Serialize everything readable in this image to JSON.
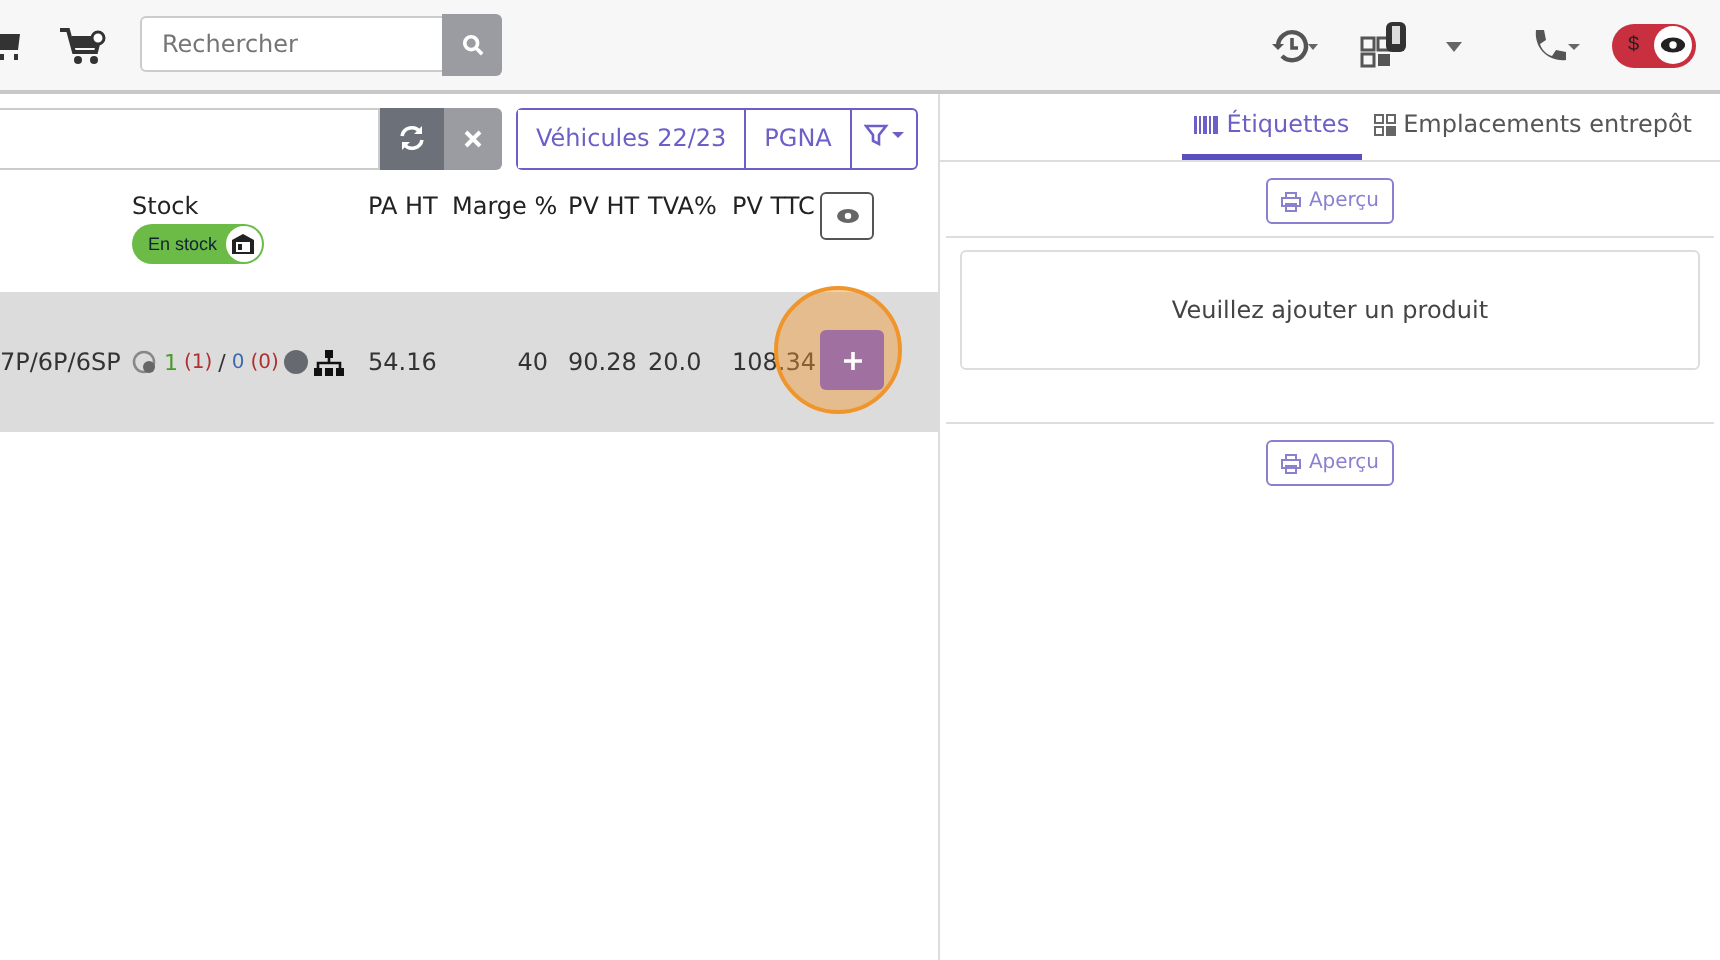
{
  "search": {
    "placeholder": "Rechercher"
  },
  "price_toggle": {
    "label": "$",
    "on": true
  },
  "tabs": [
    {
      "label": "Étiquettes",
      "selected": true,
      "kind": "barcode"
    },
    {
      "label": "Emplacements entrepôt",
      "selected": false,
      "kind": "qr"
    }
  ],
  "filters": [
    "Véhicules 22/23",
    "PGNA"
  ],
  "columns": {
    "stock": "Stock",
    "stock_toggle": {
      "label": "En stock",
      "on": true
    },
    "others": [
      "PA HT",
      "Marge %",
      "PV HT",
      "TVA%",
      "PV TTC"
    ]
  },
  "rows": [
    {
      "name": "7P/6P/6SP",
      "stock": {
        "available": "1",
        "available_reserved": "(1)",
        "separator": "/",
        "incoming": "0",
        "incoming_reserved": "(0)"
      },
      "values": [
        "54.16",
        "40",
        "90.28",
        "20.0",
        "108.34"
      ],
      "highlighted": true
    }
  ],
  "preview_buttons": [
    "Aperçu",
    "Aperçu"
  ],
  "empty_message": "Veuillez ajouter un produit"
}
